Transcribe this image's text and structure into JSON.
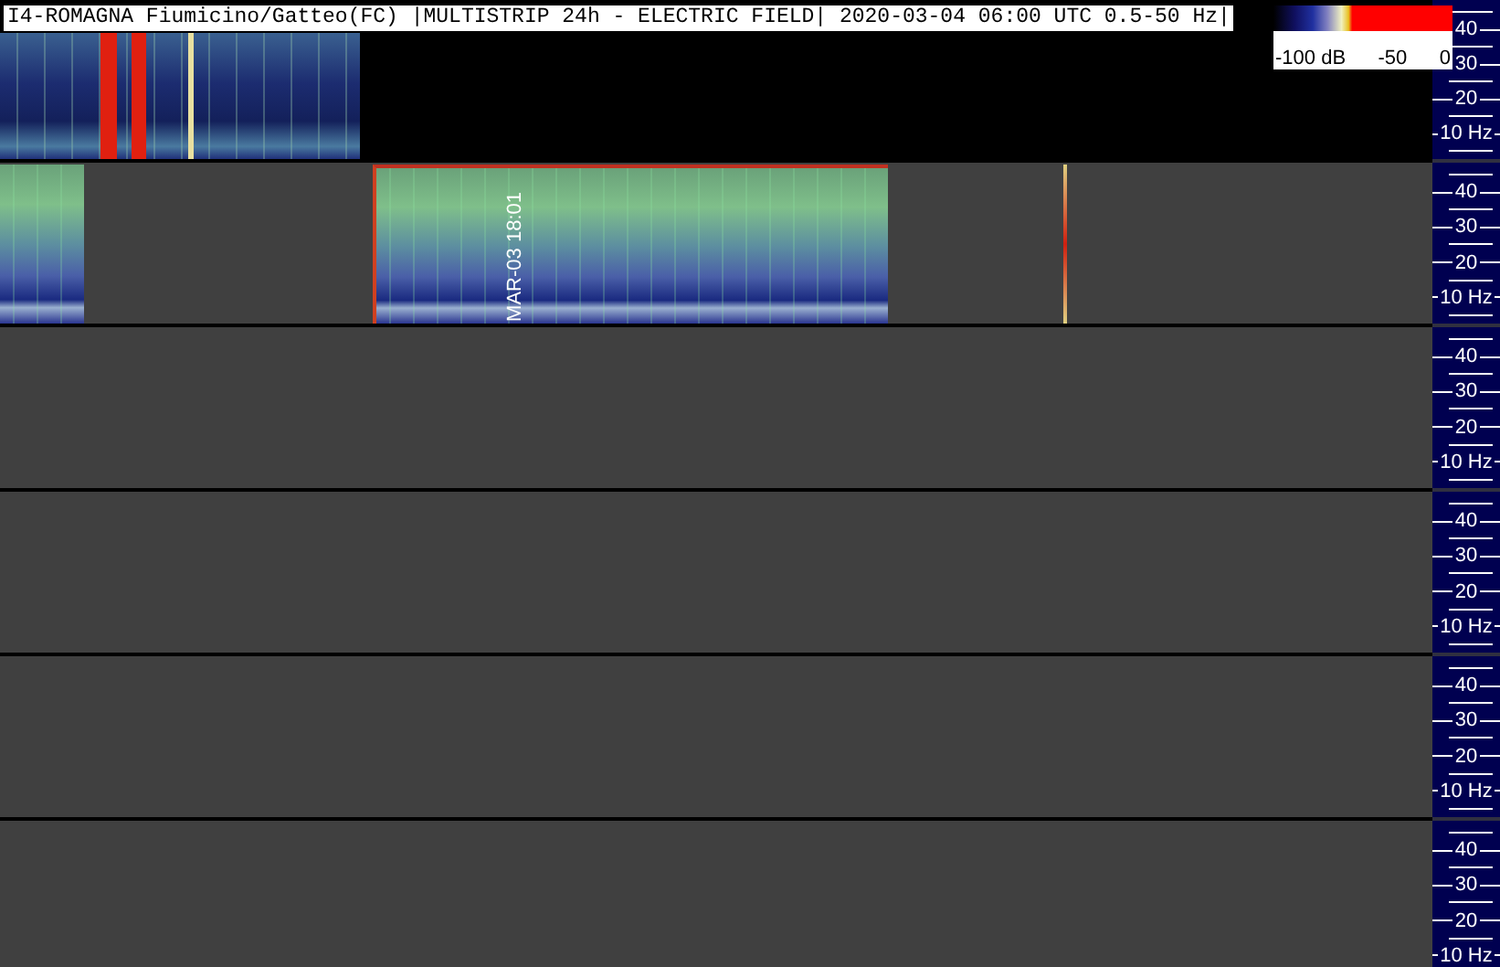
{
  "title": "I4-ROMAGNA Fiumicino/Gatteo(FC) |MULTISTRIP 24h - ELECTRIC FIELD| 2020-03-04 06:00 UTC 0.5-50 Hz|",
  "colorbar": {
    "labels": [
      "-100 dB",
      "-50",
      "0"
    ]
  },
  "strips": [
    {
      "axis_labels": [
        "40",
        "30",
        "20",
        "10 Hz"
      ]
    },
    {
      "axis_labels": [
        "40",
        "30",
        "20",
        "10 Hz"
      ],
      "time_label": "MAR-03 18:01"
    },
    {
      "axis_labels": [
        "40",
        "30",
        "20",
        "10 Hz"
      ]
    },
    {
      "axis_labels": [
        "40",
        "30",
        "20",
        "10 Hz"
      ]
    },
    {
      "axis_labels": [
        "40",
        "30",
        "20",
        "10 Hz"
      ]
    },
    {
      "axis_labels": [
        "40",
        "30",
        "20",
        "10 Hz"
      ]
    }
  ]
}
